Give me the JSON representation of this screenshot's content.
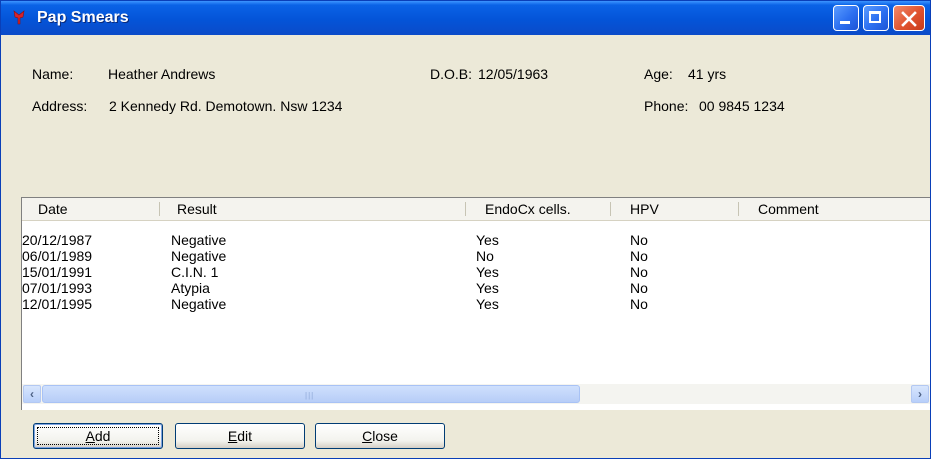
{
  "window": {
    "title": "Pap Smears",
    "icon": "app-red-icon"
  },
  "titlebar_buttons": {
    "minimize": "minimize-icon",
    "maximize": "maximize-icon",
    "close": "close-icon"
  },
  "patient": {
    "name_label": "Name:",
    "name": "Heather Andrews",
    "dob_label": "D.O.B:",
    "dob": "12/05/1963",
    "age_label": "Age:",
    "age": "41 yrs",
    "address_label": "Address:",
    "address": "2 Kennedy Rd. Demotown. Nsw 1234",
    "phone_label": "Phone:",
    "phone": "00 9845 1234"
  },
  "table": {
    "columns": [
      "Date",
      "Result",
      "EndoCx cells.",
      "HPV",
      "Comment"
    ],
    "rows": [
      [
        "20/12/1987",
        "Negative",
        "Yes",
        "No",
        ""
      ],
      [
        "06/01/1989",
        "Negative",
        "No",
        "No",
        ""
      ],
      [
        "15/01/1991",
        "C.I.N. 1",
        "Yes",
        "No",
        ""
      ],
      [
        "07/01/1993",
        "Atypia",
        "Yes",
        "No",
        ""
      ],
      [
        "12/01/1995",
        "Negative",
        "Yes",
        "No",
        ""
      ]
    ]
  },
  "buttons": {
    "add": {
      "mnemonic": "A",
      "rest": "dd"
    },
    "edit": {
      "mnemonic": "E",
      "rest": "dit"
    },
    "close": {
      "mnemonic": "C",
      "rest": "lose"
    }
  },
  "colors": {
    "title_bar": "#0454d8",
    "window_bg": "#ece9d8",
    "close_button": "#e0532f"
  }
}
